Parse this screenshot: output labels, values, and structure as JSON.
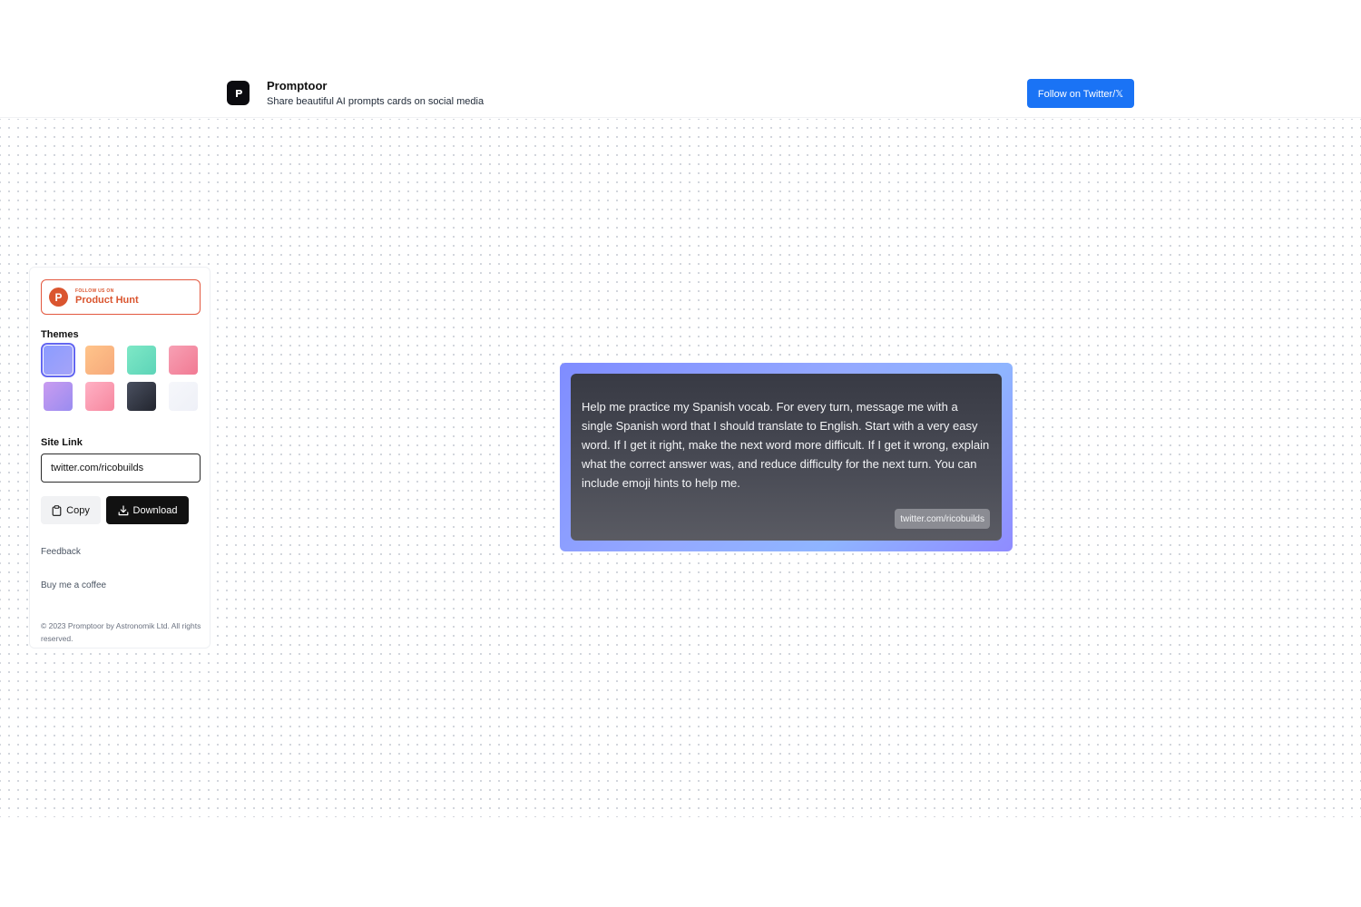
{
  "header": {
    "title": "Promptoor",
    "subtitle": "Share beautiful AI prompts cards on social media",
    "twitter_button": "Follow on Twitter/𝕏"
  },
  "sidebar": {
    "product_hunt": {
      "small": "FOLLOW US ON",
      "big": "Product Hunt",
      "letter": "P"
    },
    "themes_label": "Themes",
    "themes": [
      {
        "name": "indigo",
        "colors": [
          "#8b9cff",
          "#a5a3f8"
        ],
        "selected": true
      },
      {
        "name": "peach",
        "colors": [
          "#ffc48a",
          "#f6a97b"
        ],
        "selected": false
      },
      {
        "name": "mint",
        "colors": [
          "#7ee8c6",
          "#5dd4b8"
        ],
        "selected": false
      },
      {
        "name": "rose",
        "colors": [
          "#f7a0b4",
          "#f17a93"
        ],
        "selected": false
      },
      {
        "name": "violet",
        "colors": [
          "#c99cf0",
          "#9a8cf0"
        ],
        "selected": false
      },
      {
        "name": "pink",
        "colors": [
          "#ffb1c4",
          "#f6879f"
        ],
        "selected": false
      },
      {
        "name": "slate",
        "colors": [
          "#4a5060",
          "#22252e"
        ],
        "selected": false
      },
      {
        "name": "white",
        "colors": [
          "#f6f7fb",
          "#eef0f7"
        ],
        "selected": false
      }
    ],
    "site_link_label": "Site Link",
    "site_link_value": "twitter.com/ricobuilds",
    "copy_label": "Copy",
    "download_label": "Download",
    "feedback_label": "Feedback",
    "coffee_label": "Buy me a coffee",
    "copyright": "© 2023 Promptoor by Astronomik Ltd. All rights reserved."
  },
  "card": {
    "text": "Help me practice my Spanish vocab. For every turn, message me with a single Spanish word that I should translate to English. Start with a very easy word. If I get it right, make the next word more difficult. If I get it wrong, explain what the correct answer was, and reduce difficulty for the next turn. You can include emoji hints to help me.",
    "link": "twitter.com/ricobuilds"
  }
}
